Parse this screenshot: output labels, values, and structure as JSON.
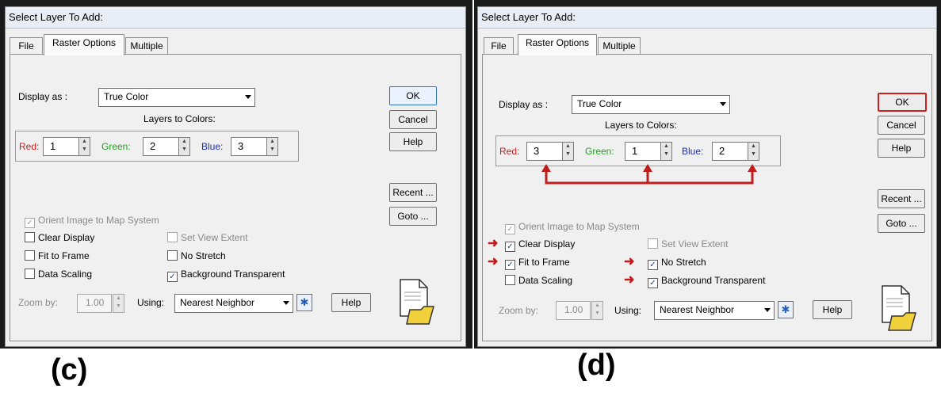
{
  "panels": [
    {
      "caption": "(c)",
      "title": "Select Layer To Add:",
      "tabs": [
        "File",
        "Raster Options",
        "Multiple"
      ],
      "display_as_label": "Display as :",
      "display_as_value": "True Color",
      "layers_to_colors_label": "Layers to Colors:",
      "red_label": "Red:",
      "red_value": "1",
      "green_label": "Green:",
      "green_value": "2",
      "blue_label": "Blue:",
      "blue_value": "3",
      "buttons": {
        "ok": "OK",
        "cancel": "Cancel",
        "help": "Help",
        "recent": "Recent ...",
        "goto": "Goto ..."
      },
      "orient": "Orient Image to Map System",
      "clear_display": "Clear Display",
      "set_view_extent": "Set View Extent",
      "fit_to_frame": "Fit to Frame",
      "no_stretch": "No Stretch",
      "data_scaling": "Data Scaling",
      "background_transparent": "Background Transparent",
      "zoom_by_label": "Zoom by:",
      "zoom_value": "1.00",
      "using_label": "Using:",
      "resample_method": "Nearest Neighbor",
      "help2": "Help",
      "checked": {
        "orient": true,
        "clear_display": false,
        "set_view_extent": false,
        "fit_to_frame": false,
        "no_stretch": false,
        "data_scaling": false,
        "background_transparent": true
      }
    },
    {
      "caption": "(d)",
      "title": "Select Layer To Add:",
      "tabs": [
        "File",
        "Raster Options",
        "Multiple"
      ],
      "display_as_label": "Display as :",
      "display_as_value": "True Color",
      "layers_to_colors_label": "Layers to Colors:",
      "red_label": "Red:",
      "red_value": "3",
      "green_label": "Green:",
      "green_value": "1",
      "blue_label": "Blue:",
      "blue_value": "2",
      "buttons": {
        "ok": "OK",
        "cancel": "Cancel",
        "help": "Help",
        "recent": "Recent ...",
        "goto": "Goto ..."
      },
      "orient": "Orient Image to Map System",
      "clear_display": "Clear Display",
      "set_view_extent": "Set View Extent",
      "fit_to_frame": "Fit to Frame",
      "no_stretch": "No Stretch",
      "data_scaling": "Data Scaling",
      "background_transparent": "Background Transparent",
      "zoom_by_label": "Zoom by:",
      "zoom_value": "1.00",
      "using_label": "Using:",
      "resample_method": "Nearest Neighbor",
      "help2": "Help",
      "checked": {
        "orient": true,
        "clear_display": true,
        "set_view_extent": false,
        "fit_to_frame": true,
        "no_stretch": true,
        "data_scaling": false,
        "background_transparent": true
      }
    }
  ],
  "colors": {
    "red_label": "#c41e1e",
    "green_label": "#1fa31f",
    "blue_label": "#1c2fb5",
    "annotation": "#c21b1b"
  },
  "icons": [
    "file-folder-icon",
    "star-icon",
    "spin-up-down-icon",
    "dropdown-arrow-icon",
    "annotation-arrow-icon"
  ]
}
